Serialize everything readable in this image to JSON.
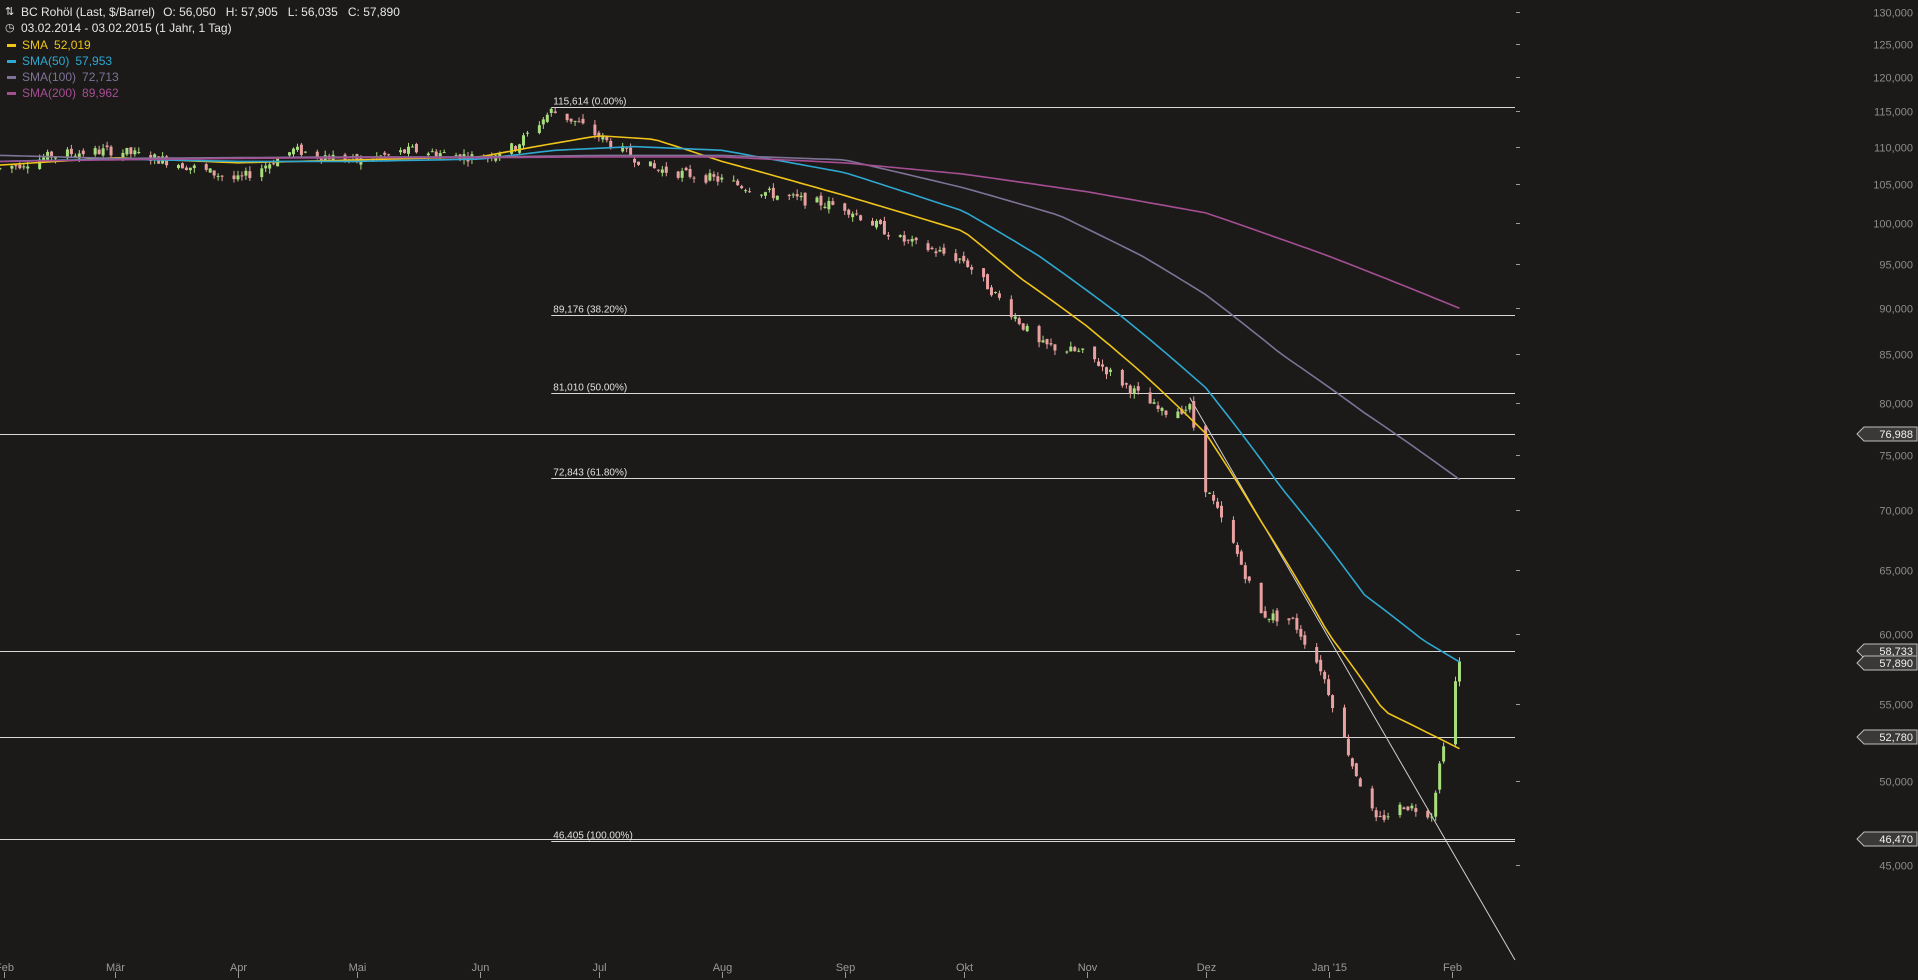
{
  "header": {
    "instrument": "BC Rohöl (Last, $/Barrel)",
    "ohlc": "O: 56,050   H: 57,905   L: 56,035   C: 57,890",
    "range": "03.02.2014 - 03.02.2015 (1 Jahr, 1 Tag)",
    "instrument_icon": "bar-chart-icon",
    "range_icon": "clock-icon"
  },
  "legend": [
    {
      "name": "SMA",
      "value": "52,019",
      "color": "#f0c419"
    },
    {
      "name": "SMA(50)",
      "value": "57,953",
      "color": "#2ea8d0"
    },
    {
      "name": "SMA(100)",
      "value": "72,713",
      "color": "#7e7396"
    },
    {
      "name": "SMA(200)",
      "value": "89,962",
      "color": "#a54e92"
    }
  ],
  "chart_data": {
    "type": "candlestick",
    "title": "BC Rohöl (Last, $/Barrel)",
    "x_tick_labels": [
      "Feb",
      "Mär",
      "Apr",
      "Mai",
      "Jun",
      "Jul",
      "Aug",
      "Sep",
      "Okt",
      "Nov",
      "Dez",
      "Jan '15",
      "Feb"
    ],
    "x_tick_dates": [
      "2014-02-01",
      "2014-03-01",
      "2014-04-01",
      "2014-05-01",
      "2014-06-01",
      "2014-07-01",
      "2014-08-01",
      "2014-09-01",
      "2014-10-01",
      "2014-11-01",
      "2014-12-01",
      "2015-01-01",
      "2015-02-01"
    ],
    "x_start": "2014-01-31",
    "x_end": "2015-02-17",
    "y_ticks": [
      45,
      50,
      55,
      60,
      65,
      70,
      75,
      80,
      85,
      90,
      95,
      100,
      105,
      110,
      115,
      120,
      125,
      130
    ],
    "y_tick_labels": [
      "45,000",
      "50,000",
      "55,000",
      "60,000",
      "65,000",
      "70,000",
      "75,000",
      "80,000",
      "85,000",
      "90,000",
      "95,000",
      "100,000",
      "105,000",
      "110,000",
      "115,000",
      "120,000",
      "125,000",
      "130,000"
    ],
    "ylim": [
      40,
      132
    ],
    "y_scale": "log",
    "grid": false,
    "up_color": "#a8dd7c",
    "down_color": "#e8a0a0",
    "price_path": [
      [
        "2014-01-31",
        107.0
      ],
      [
        "2014-02-15",
        109.0
      ],
      [
        "2014-03-01",
        109.5
      ],
      [
        "2014-03-15",
        108.0
      ],
      [
        "2014-04-01",
        105.5
      ],
      [
        "2014-04-15",
        109.5
      ],
      [
        "2014-05-01",
        108.0
      ],
      [
        "2014-05-15",
        109.5
      ],
      [
        "2014-06-01",
        108.5
      ],
      [
        "2014-06-10",
        110.0
      ],
      [
        "2014-06-19",
        115.0
      ],
      [
        "2014-06-25",
        113.5
      ],
      [
        "2014-07-05",
        110.0
      ],
      [
        "2014-07-15",
        107.0
      ],
      [
        "2014-08-01",
        105.5
      ],
      [
        "2014-08-15",
        103.5
      ],
      [
        "2014-09-01",
        102.0
      ],
      [
        "2014-09-15",
        98.0
      ],
      [
        "2014-10-01",
        95.5
      ],
      [
        "2014-10-10",
        91.0
      ],
      [
        "2014-10-20",
        86.0
      ],
      [
        "2014-11-01",
        85.0
      ],
      [
        "2014-11-10",
        82.0
      ],
      [
        "2014-11-20",
        79.0
      ],
      [
        "2014-11-27",
        79.5
      ],
      [
        "2014-12-01",
        72.0
      ],
      [
        "2014-12-08",
        67.0
      ],
      [
        "2014-12-15",
        61.5
      ],
      [
        "2014-12-23",
        61.0
      ],
      [
        "2014-12-30",
        57.5
      ],
      [
        "2015-01-07",
        51.0
      ],
      [
        "2015-01-13",
        47.5
      ],
      [
        "2015-01-20",
        48.5
      ],
      [
        "2015-01-27",
        48.0
      ],
      [
        "2015-01-30",
        52.5
      ],
      [
        "2015-02-03",
        57.89
      ]
    ],
    "series": [
      {
        "name": "SMA",
        "color": "#f0c419",
        "values": [
          [
            "2014-01-31",
            107.5
          ],
          [
            "2014-03-01",
            108.5
          ],
          [
            "2014-04-01",
            107.8
          ],
          [
            "2014-05-01",
            108.2
          ],
          [
            "2014-06-01",
            108.6
          ],
          [
            "2014-06-15",
            110.0
          ],
          [
            "2014-07-01",
            111.5
          ],
          [
            "2014-07-15",
            111.0
          ],
          [
            "2014-08-01",
            108.0
          ],
          [
            "2014-09-01",
            103.5
          ],
          [
            "2014-10-01",
            99.0
          ],
          [
            "2014-10-15",
            93.5
          ],
          [
            "2014-11-01",
            88.0
          ],
          [
            "2014-11-15",
            83.0
          ],
          [
            "2014-12-01",
            77.0
          ],
          [
            "2014-12-15",
            69.0
          ],
          [
            "2015-01-01",
            60.0
          ],
          [
            "2015-01-15",
            54.5
          ],
          [
            "2015-02-03",
            52.02
          ]
        ]
      },
      {
        "name": "SMA(50)",
        "color": "#2ea8d0",
        "values": [
          [
            "2014-01-31",
            108.0
          ],
          [
            "2014-03-01",
            108.3
          ],
          [
            "2014-04-01",
            108.0
          ],
          [
            "2014-05-01",
            108.0
          ],
          [
            "2014-06-01",
            108.3
          ],
          [
            "2014-06-20",
            109.5
          ],
          [
            "2014-07-10",
            110.0
          ],
          [
            "2014-08-01",
            109.5
          ],
          [
            "2014-09-01",
            106.5
          ],
          [
            "2014-10-01",
            101.5
          ],
          [
            "2014-10-20",
            96.0
          ],
          [
            "2014-11-10",
            89.0
          ],
          [
            "2014-12-01",
            81.5
          ],
          [
            "2014-12-20",
            72.0
          ],
          [
            "2015-01-10",
            63.0
          ],
          [
            "2015-01-25",
            59.5
          ],
          [
            "2015-02-03",
            57.95
          ]
        ]
      },
      {
        "name": "SMA(100)",
        "color": "#7e7396",
        "values": [
          [
            "2014-01-31",
            108.8
          ],
          [
            "2014-03-01",
            108.4
          ],
          [
            "2014-04-01",
            108.5
          ],
          [
            "2014-05-01",
            108.6
          ],
          [
            "2014-06-01",
            108.6
          ],
          [
            "2014-07-01",
            108.8
          ],
          [
            "2014-08-01",
            108.8
          ],
          [
            "2014-09-01",
            108.2
          ],
          [
            "2014-10-01",
            104.5
          ],
          [
            "2014-10-25",
            101.0
          ],
          [
            "2014-11-15",
            96.0
          ],
          [
            "2014-12-01",
            91.5
          ],
          [
            "2014-12-20",
            85.0
          ],
          [
            "2015-01-10",
            79.0
          ],
          [
            "2015-02-03",
            72.71
          ]
        ]
      },
      {
        "name": "SMA(200)",
        "color": "#a54e92",
        "values": [
          [
            "2014-01-31",
            108.0
          ],
          [
            "2014-03-01",
            108.2
          ],
          [
            "2014-04-01",
            108.4
          ],
          [
            "2014-05-01",
            108.5
          ],
          [
            "2014-06-01",
            108.5
          ],
          [
            "2014-07-01",
            108.6
          ],
          [
            "2014-08-01",
            108.6
          ],
          [
            "2014-09-01",
            107.8
          ],
          [
            "2014-10-01",
            106.3
          ],
          [
            "2014-11-01",
            104.0
          ],
          [
            "2014-12-01",
            101.3
          ],
          [
            "2015-01-01",
            96.0
          ],
          [
            "2015-02-03",
            89.96
          ]
        ]
      }
    ],
    "fibonacci": {
      "start_date": "2014-06-19",
      "levels": [
        {
          "label": "115,614 (0.00%)",
          "value": 115.614
        },
        {
          "label": "89,176 (38.20%)",
          "value": 89.176
        },
        {
          "label": "81,010 (50.00%)",
          "value": 81.01
        },
        {
          "label": "72,843 (61.80%)",
          "value": 72.843
        },
        {
          "label": "46,405 (100.00%)",
          "value": 46.405
        }
      ]
    },
    "horizontal_lines": [
      {
        "value": 76.988,
        "label": "76,988"
      },
      {
        "value": 58.733,
        "label": "58,733"
      },
      {
        "value": 52.78,
        "label": "52,780"
      },
      {
        "value": 46.47,
        "label": "46,470"
      }
    ],
    "current_price": {
      "value": 57.89,
      "label": "57,890"
    },
    "trendline": {
      "from": [
        "2014-11-27",
        80.5
      ],
      "to": [
        "2015-02-17",
        40.0
      ]
    }
  }
}
